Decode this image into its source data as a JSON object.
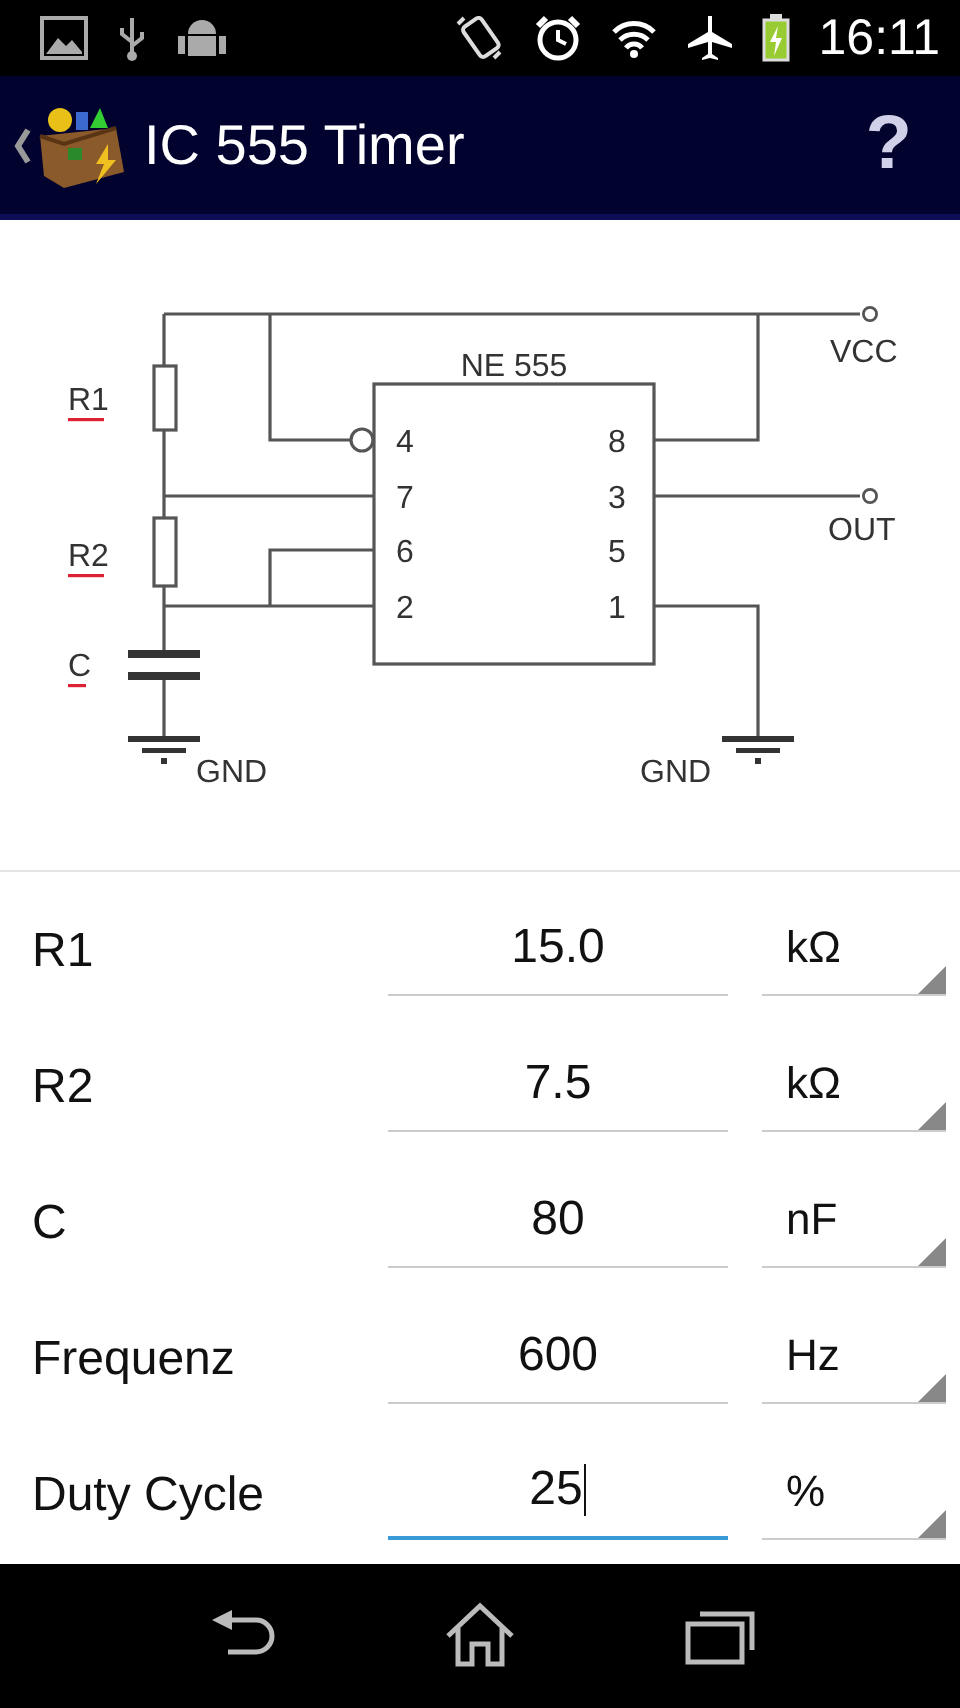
{
  "status_bar": {
    "time": "16:11"
  },
  "app_bar": {
    "title": "IC 555 Timer",
    "help": "?"
  },
  "schematic": {
    "chip": "NE 555",
    "left_pins": [
      "4",
      "7",
      "6",
      "2"
    ],
    "right_pins": [
      "8",
      "3",
      "5",
      "1"
    ],
    "components": [
      "R1",
      "R2",
      "C"
    ],
    "terminals": [
      "VCC",
      "OUT"
    ],
    "grounds": [
      "GND",
      "GND"
    ]
  },
  "fields": [
    {
      "label": "R1",
      "value": "15.0",
      "unit": "kΩ",
      "focused": false
    },
    {
      "label": "R2",
      "value": "7.5",
      "unit": "kΩ",
      "focused": false
    },
    {
      "label": "C",
      "value": "80",
      "unit": "nF",
      "focused": false
    },
    {
      "label": "Frequenz",
      "value": "600",
      "unit": "Hz",
      "focused": false
    },
    {
      "label": "Duty Cycle",
      "value": "25",
      "unit": "%",
      "focused": true
    }
  ]
}
